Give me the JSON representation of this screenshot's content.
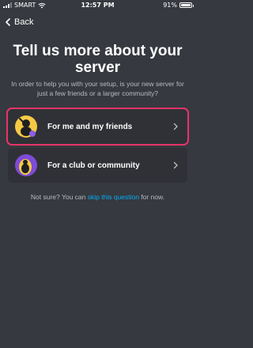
{
  "status_bar": {
    "carrier": "SMART",
    "time": "12:57 PM",
    "battery": "91%"
  },
  "header": {
    "back_label": "Back"
  },
  "main": {
    "title": "Tell us more about your server",
    "subtitle": "In order to help you with your setup, is your new server for just a few friends or a larger community?",
    "options": [
      {
        "label": "For me and my friends",
        "icon": "friends-illustration-icon"
      },
      {
        "label": "For a club or community",
        "icon": "community-illustration-icon"
      }
    ],
    "footer": {
      "prefix": "Not sure? You can ",
      "link": "skip this question",
      "suffix": " for now."
    }
  },
  "colors": {
    "background": "#36393f",
    "card": "#2f3136",
    "highlight": "#e8336a",
    "link": "#00aff4",
    "muted_text": "#b9bbbe"
  }
}
